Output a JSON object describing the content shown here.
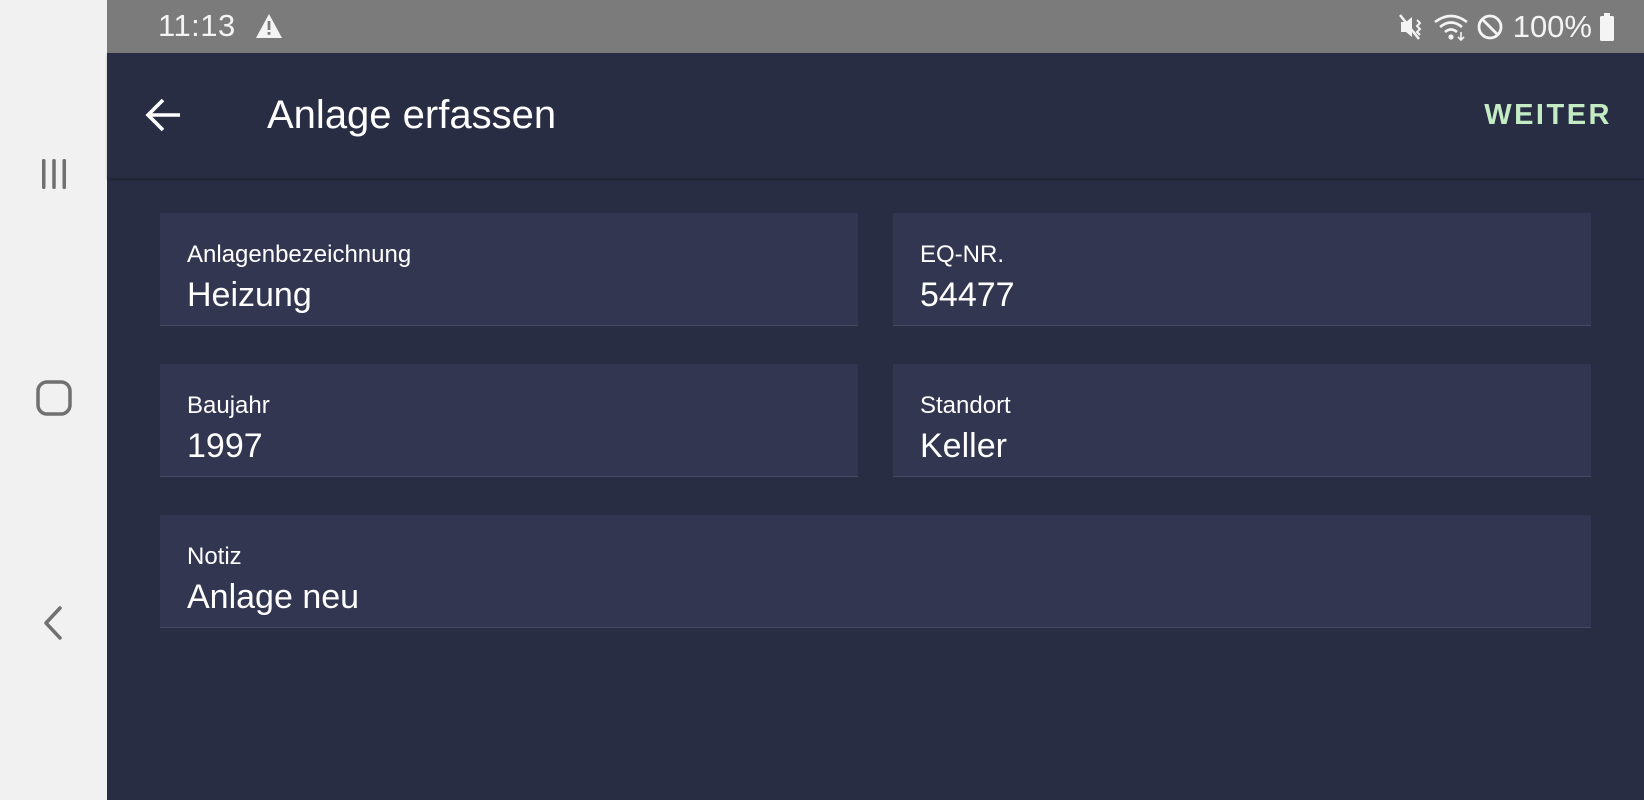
{
  "status_bar": {
    "time": "11:13",
    "battery_text": "100%",
    "icons": [
      "warning-icon",
      "mute-vibrate-icon",
      "wifi-icon",
      "do-not-disturb-icon",
      "battery-icon"
    ]
  },
  "nav_bar": {
    "buttons": [
      "recents-icon",
      "home-icon",
      "back-icon"
    ]
  },
  "toolbar": {
    "title": "Anlage erfassen",
    "action_label": "WEITER",
    "action_color": "#c4ecc4"
  },
  "form": {
    "fields": [
      {
        "label": "Anlagenbezeichnung",
        "value": "Heizung"
      },
      {
        "label": "EQ-NR.",
        "value": "54477"
      },
      {
        "label": "Baujahr",
        "value": "1997"
      },
      {
        "label": "Standort",
        "value": "Keller"
      },
      {
        "label": "Notiz",
        "value": "Anlage neu"
      }
    ]
  },
  "colors": {
    "background": "#282d44",
    "field_background": "#323651",
    "status_bar": "#7b7b7b",
    "nav_bar": "#f1f1f1"
  }
}
